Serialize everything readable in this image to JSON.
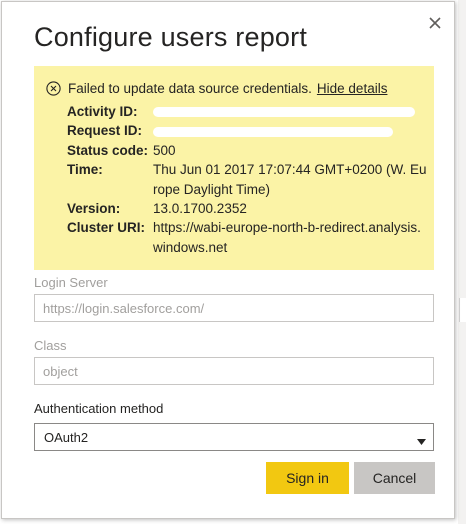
{
  "dialog": {
    "title": "Configure users report",
    "close_icon": "close-icon"
  },
  "error": {
    "icon": "error-circle-x-icon",
    "message": "Failed to update data source credentials.",
    "hide_details": "Hide details",
    "details": [
      {
        "label": "Activity ID:",
        "value": ""
      },
      {
        "label": "Request ID:",
        "value": ""
      },
      {
        "label": "Status code:",
        "value": "500"
      },
      {
        "label": "Time:",
        "value": "Thu Jun 01 2017 17:07:44 GMT+0200 (W. Europe Daylight Time)"
      },
      {
        "label": "Version:",
        "value": "13.0.1700.2352"
      },
      {
        "label": "Cluster URI:",
        "value": "https://wabi-europe-north-b-redirect.analysis.windows.net"
      }
    ]
  },
  "form": {
    "login_server": {
      "label": "Login Server",
      "placeholder": "https://login.salesforce.com/"
    },
    "class": {
      "label": "Class",
      "placeholder": "object"
    },
    "auth_method": {
      "label": "Authentication method",
      "value": "OAuth2"
    }
  },
  "buttons": {
    "sign_in": "Sign in",
    "cancel": "Cancel"
  },
  "colors": {
    "accent": "#f2c811",
    "error_background": "#fbf3a6",
    "secondary_button": "#c8c6c4"
  }
}
